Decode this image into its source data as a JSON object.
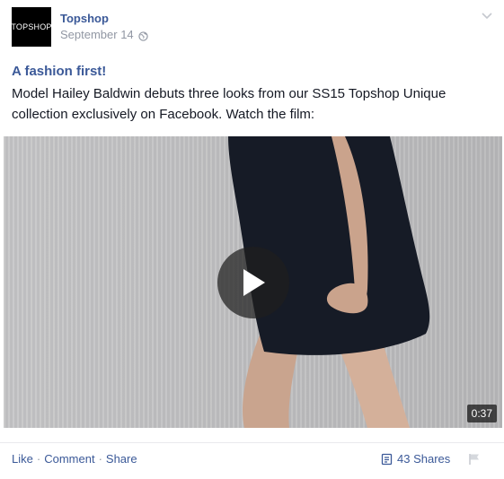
{
  "post": {
    "avatar_text": "TOPSHOP",
    "page_name": "Topshop",
    "date": "September 14",
    "privacy_icon": "globe-icon",
    "menu_icon": "chevron-down-icon",
    "headline": "A fashion first!",
    "body": "Model Hailey Baldwin debuts three looks from our SS15 Topshop Unique collection exclusively on Facebook. Watch the film:"
  },
  "video": {
    "duration": "0:37",
    "play_icon": "play-icon"
  },
  "footer": {
    "like": "Like",
    "comment": "Comment",
    "share": "Share",
    "separator": "·",
    "shares_count": "43 Shares",
    "shares_icon": "shares-icon",
    "flag_icon": "flag-icon"
  },
  "colors": {
    "link": "#3b5998",
    "text": "#141823",
    "meta": "#9197a3"
  }
}
